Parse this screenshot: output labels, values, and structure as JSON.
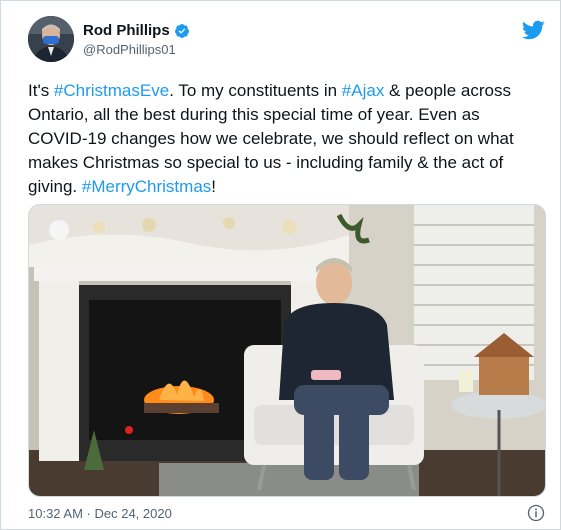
{
  "author": {
    "name": "Rod Phillips",
    "handle": "@RodPhillips01",
    "verified": true
  },
  "tweet": {
    "segments": [
      {
        "text": "It's ",
        "type": "text"
      },
      {
        "text": "#ChristmasEve",
        "type": "hashtag"
      },
      {
        "text": ". To my constituents in ",
        "type": "text"
      },
      {
        "text": "#Ajax",
        "type": "hashtag"
      },
      {
        "text": " & people across Ontario, all the best during this special time of year. Even as COVID-19 changes how we celebrate, we should reflect on what makes Christmas so special to us - including family & the act of giving. ",
        "type": "text"
      },
      {
        "text": "#MerryChristmas",
        "type": "hashtag"
      },
      {
        "text": "!",
        "type": "text"
      }
    ]
  },
  "timestamp": "10:32 AM · Dec 24, 2020",
  "icons": {
    "brand": "twitter-bird-icon",
    "verified": "verified-badge-icon",
    "info": "info-icon"
  },
  "colors": {
    "hashtag": "#1d9bf0",
    "brand": "#1d9bf0",
    "text": "#0f1419",
    "muted": "#536471"
  }
}
